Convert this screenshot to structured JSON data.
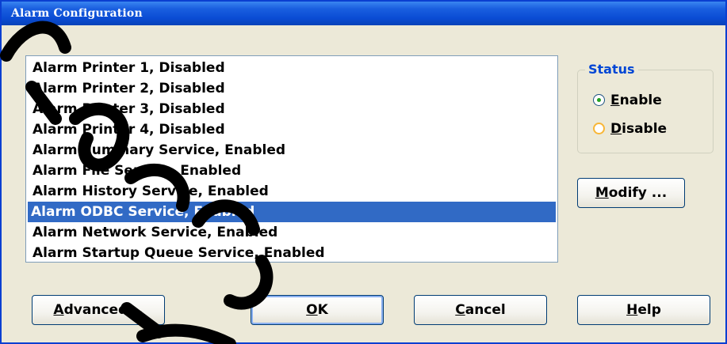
{
  "window": {
    "title": "Alarm Configuration"
  },
  "list": {
    "items": [
      "Alarm Printer 1, Disabled",
      "Alarm Printer 2, Disabled",
      "Alarm Printer 3, Disabled",
      "Alarm Printer 4, Disabled",
      "Alarm Summary Service, Enabled",
      "Alarm File Service, Enabled",
      "Alarm History Service, Enabled",
      "Alarm ODBC Service, Enabled",
      "Alarm Network Service, Enabled",
      "Alarm Startup Queue Service, Enabled"
    ],
    "selected": "Alarm ODBC Service, Enabled"
  },
  "status": {
    "legend": "Status",
    "enable": {
      "letter": "E",
      "rest": "nable"
    },
    "disable": {
      "letter": "D",
      "rest": "isable"
    },
    "selected": "Enable"
  },
  "buttons": {
    "modify": {
      "letter": "M",
      "rest": "odify ..."
    },
    "advanced": {
      "letter": "A",
      "rest": "dvanced..."
    },
    "ok": {
      "letter": "O",
      "rest": "K"
    },
    "cancel": {
      "letter": "C",
      "rest": "ancel"
    },
    "help": {
      "letter": "H",
      "rest": "elp"
    }
  },
  "colors": {
    "title_bar": "#0a4cd4",
    "selection": "#316ac5",
    "legend": "#0046d5",
    "watermark": "#000000"
  },
  "icons": {
    "enable_radio": "radio-checked",
    "disable_radio": "radio-unchecked"
  }
}
